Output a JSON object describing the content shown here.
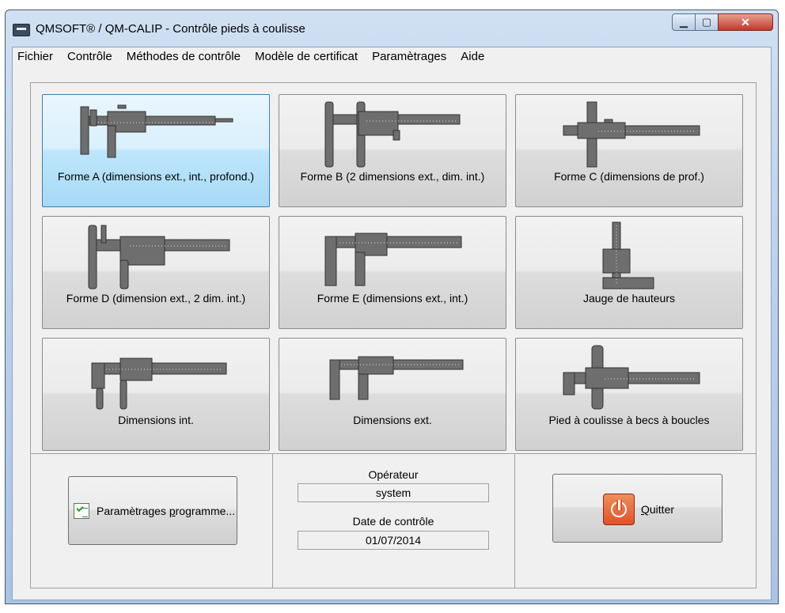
{
  "window": {
    "title": "QMSOFT® / QM-CALIP - Contrôle pieds à coulisse"
  },
  "controls": {
    "minimize": "▁",
    "maximize": "▢",
    "close": "✕"
  },
  "menu": [
    "Fichier",
    "Contrôle",
    "Méthodes de contrôle",
    "Modèle de certificat",
    "Paramètrages",
    "Aide"
  ],
  "tiles": [
    {
      "label": "Forme A (dimensions ext., int., profond.)",
      "icon": "caliper-form-a-icon",
      "selected": true
    },
    {
      "label": "Forme B (2 dimensions ext., dim. int.)",
      "icon": "caliper-form-b-icon"
    },
    {
      "label": "Forme C (dimensions de prof.)",
      "icon": "caliper-form-c-icon"
    },
    {
      "label": "Forme D (dimension ext., 2 dim. int.)",
      "icon": "caliper-form-d-icon"
    },
    {
      "label": "Forme E (dimensions ext., int.)",
      "icon": "caliper-form-e-icon"
    },
    {
      "label": "Jauge de hauteurs",
      "icon": "height-gauge-icon"
    },
    {
      "label": "Dimensions int.",
      "icon": "caliper-internal-icon"
    },
    {
      "label": "Dimensions ext.",
      "icon": "caliper-external-icon"
    },
    {
      "label": "Pied à coulisse à becs à boucles",
      "icon": "caliper-loop-jaws-icon"
    }
  ],
  "footer": {
    "program_settings": {
      "prefix": "Paramètrages ",
      "underlined": "p",
      "suffix": "rogramme..."
    },
    "operator_label": "Opérateur",
    "operator_value": "system",
    "date_label": "Date de contrôle",
    "date_value": "01/07/2014",
    "quit": {
      "underlined": "Q",
      "suffix": "uitter"
    }
  },
  "colors": {
    "selected_tile": "#bee6fd",
    "quit_icon": "#e1512b",
    "caliper": "#6e6e6e"
  }
}
